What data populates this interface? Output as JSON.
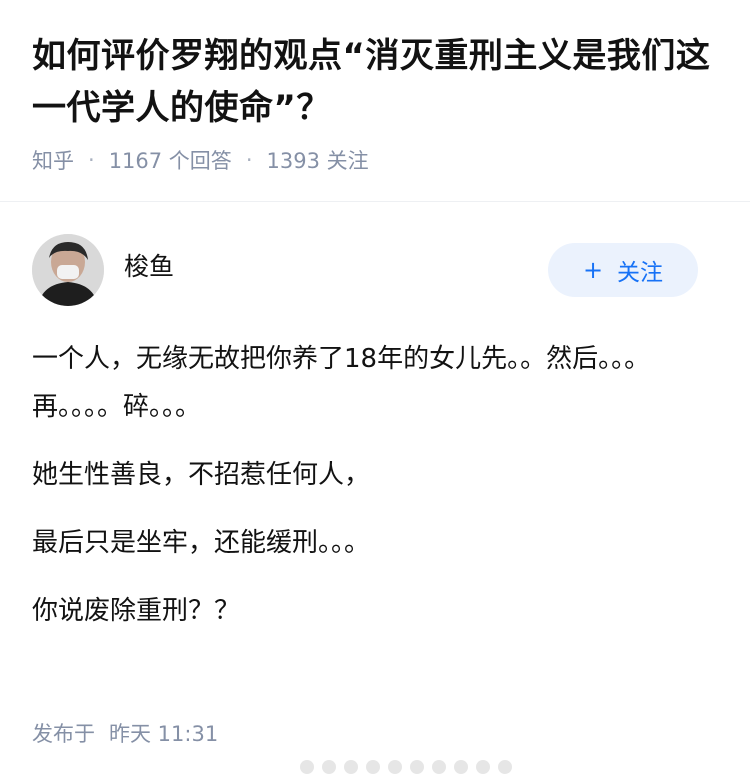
{
  "question": {
    "title": "如何评价罗翔的观点“消灭重刑主义是我们这一代学人的使命”？",
    "source": "知乎",
    "answers": "1167 个回答",
    "followers": "1393 关注",
    "separator": "·"
  },
  "author": {
    "name": "梭鱼",
    "follow_icon": "+",
    "follow_label": "关注"
  },
  "answer": {
    "paragraphs": [
      "一个人，无缘无故把你养了18年的女儿先。。然后。。。再。。。。碎。。。",
      "她生性善良，不招惹任何人，",
      "最后只是坐牢，还能缓刑。。。",
      "你说废除重刑？？"
    ],
    "published_label": "发布于",
    "published_time": "昨天 11:31"
  },
  "colors": {
    "accent": "#1772f6",
    "accent_bg": "#ebf2fd",
    "meta_gray": "#8590a6",
    "text": "#121212"
  }
}
